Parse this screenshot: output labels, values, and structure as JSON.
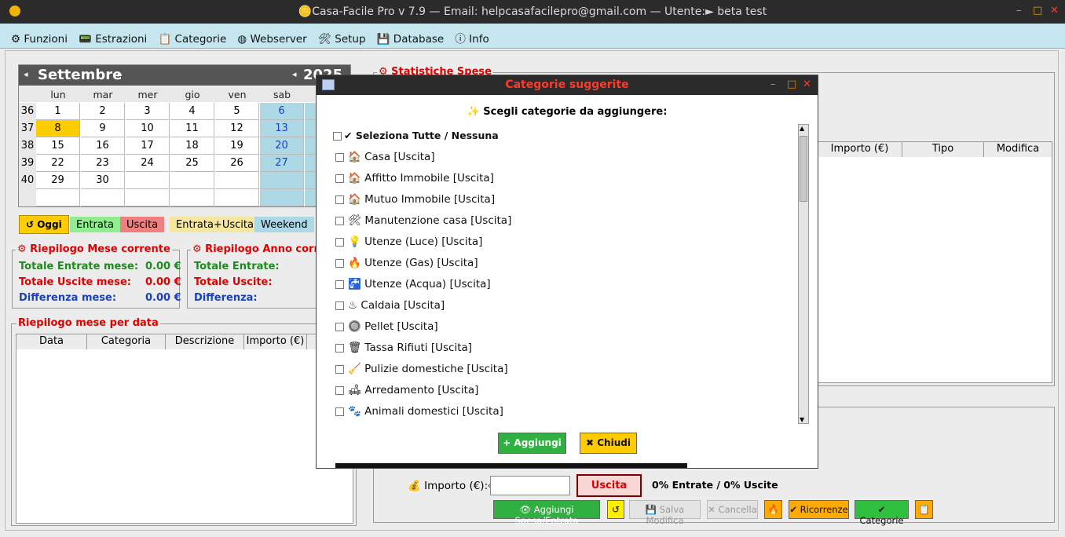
{
  "window": {
    "title": "🪙Casa-Facile Pro v 7.9  — Email: helpcasafacilepro@gmail.com —  Utente:► beta test",
    "minimize": "–",
    "maximize": "□",
    "close": "✕"
  },
  "menu": [
    {
      "icon": "⚙",
      "label": "Funzioni"
    },
    {
      "icon": "📟",
      "label": "Estrazioni"
    },
    {
      "icon": "📋",
      "label": "Categorie"
    },
    {
      "icon": "◍",
      "label": "Webserver"
    },
    {
      "icon": "🛠",
      "label": "Setup"
    },
    {
      "icon": "💾",
      "label": "Database"
    },
    {
      "icon": "ⓘ",
      "label": "Info"
    }
  ],
  "calendar": {
    "month": "Settembre",
    "year": "2025",
    "prev": "◂",
    "next": "▸",
    "daynames": [
      "lun",
      "mar",
      "mer",
      "gio",
      "ven",
      "sab"
    ],
    "weeks": [
      {
        "n": "36",
        "days": [
          "1",
          "2",
          "3",
          "4",
          "5",
          "6"
        ]
      },
      {
        "n": "37",
        "days": [
          "8",
          "9",
          "10",
          "11",
          "12",
          "13"
        ]
      },
      {
        "n": "38",
        "days": [
          "15",
          "16",
          "17",
          "18",
          "19",
          "20"
        ]
      },
      {
        "n": "39",
        "days": [
          "22",
          "23",
          "24",
          "25",
          "26",
          "27"
        ]
      },
      {
        "n": "40",
        "days": [
          "29",
          "30",
          "",
          "",
          "",
          ""
        ]
      },
      {
        "n": "",
        "days": [
          "",
          "",
          "",
          "",
          "",
          ""
        ]
      }
    ]
  },
  "legend": {
    "today": "↺ Oggi",
    "entrata": "Entrata",
    "uscita": "Uscita",
    "both": "Entrata+Uscita",
    "weekend": "Weekend"
  },
  "month_summary": {
    "title": "⚙ Riepilogo Mese corrente",
    "entrate_label": "Totale Entrate mese:",
    "entrate": "0.00 €",
    "uscite_label": "Totale Uscite mese:",
    "uscite": "0.00 €",
    "diff_label": "Differenza mese:",
    "diff": "0.00 €"
  },
  "year_summary": {
    "title": "⚙ Riepilogo Anno corrente",
    "entrate_label": "Totale Entrate:",
    "uscite_label": "Totale Uscite:",
    "diff_label": "Differenza:"
  },
  "by_date": {
    "title": "Riepilogo mese per data",
    "cols": [
      "Data",
      "Categoria",
      "Descrizione",
      "Importo (€)"
    ]
  },
  "stats": {
    "title": "⚙ Statistiche Spese",
    "cols": [
      "Importo (€)",
      "Tipo",
      "Modifica"
    ]
  },
  "form": {
    "amount_label": "💰 Importo (€):⏎",
    "amount_value": "",
    "type_button": "Uscita",
    "ratio": "0% Entrate / 0% Uscite",
    "add": "👁 Aggiungi Spesa/Entrata",
    "reset": "↺",
    "save": "💾 Salva Modifica",
    "cancel": "✕ Cancella",
    "fire": "🔥",
    "recurring": "✔ Ricorrenze",
    "categories": "✔ Categorie",
    "export": "📋"
  },
  "dialog": {
    "title": "Categorie suggerite",
    "heading": "✨ Scegli categorie da aggiungere:",
    "select_all": "✔ Seleziona Tutte / Nessuna",
    "items": [
      "🏠 Casa [Uscita]",
      "🏠 Affitto Immobile [Uscita]",
      "🏠 Mutuo Immobile [Uscita]",
      "🛠 Manutenzione casa [Uscita]",
      "💡 Utenze (Luce) [Uscita]",
      "🔥 Utenze (Gas) [Uscita]",
      "🚰 Utenze (Acqua) [Uscita]",
      "♨ Caldaia [Uscita]",
      "🔘 Pellet [Uscita]",
      "🗑 Tassa Rifiuti [Uscita]",
      "🧹 Pulizie domestiche [Uscita]",
      "🛋 Arredamento [Uscita]",
      "🐾 Animali domestici [Uscita]"
    ],
    "add": "+ Aggiungi",
    "close": "✖ Chiudi",
    "scroll_up": "▲",
    "scroll_down": "▼"
  }
}
